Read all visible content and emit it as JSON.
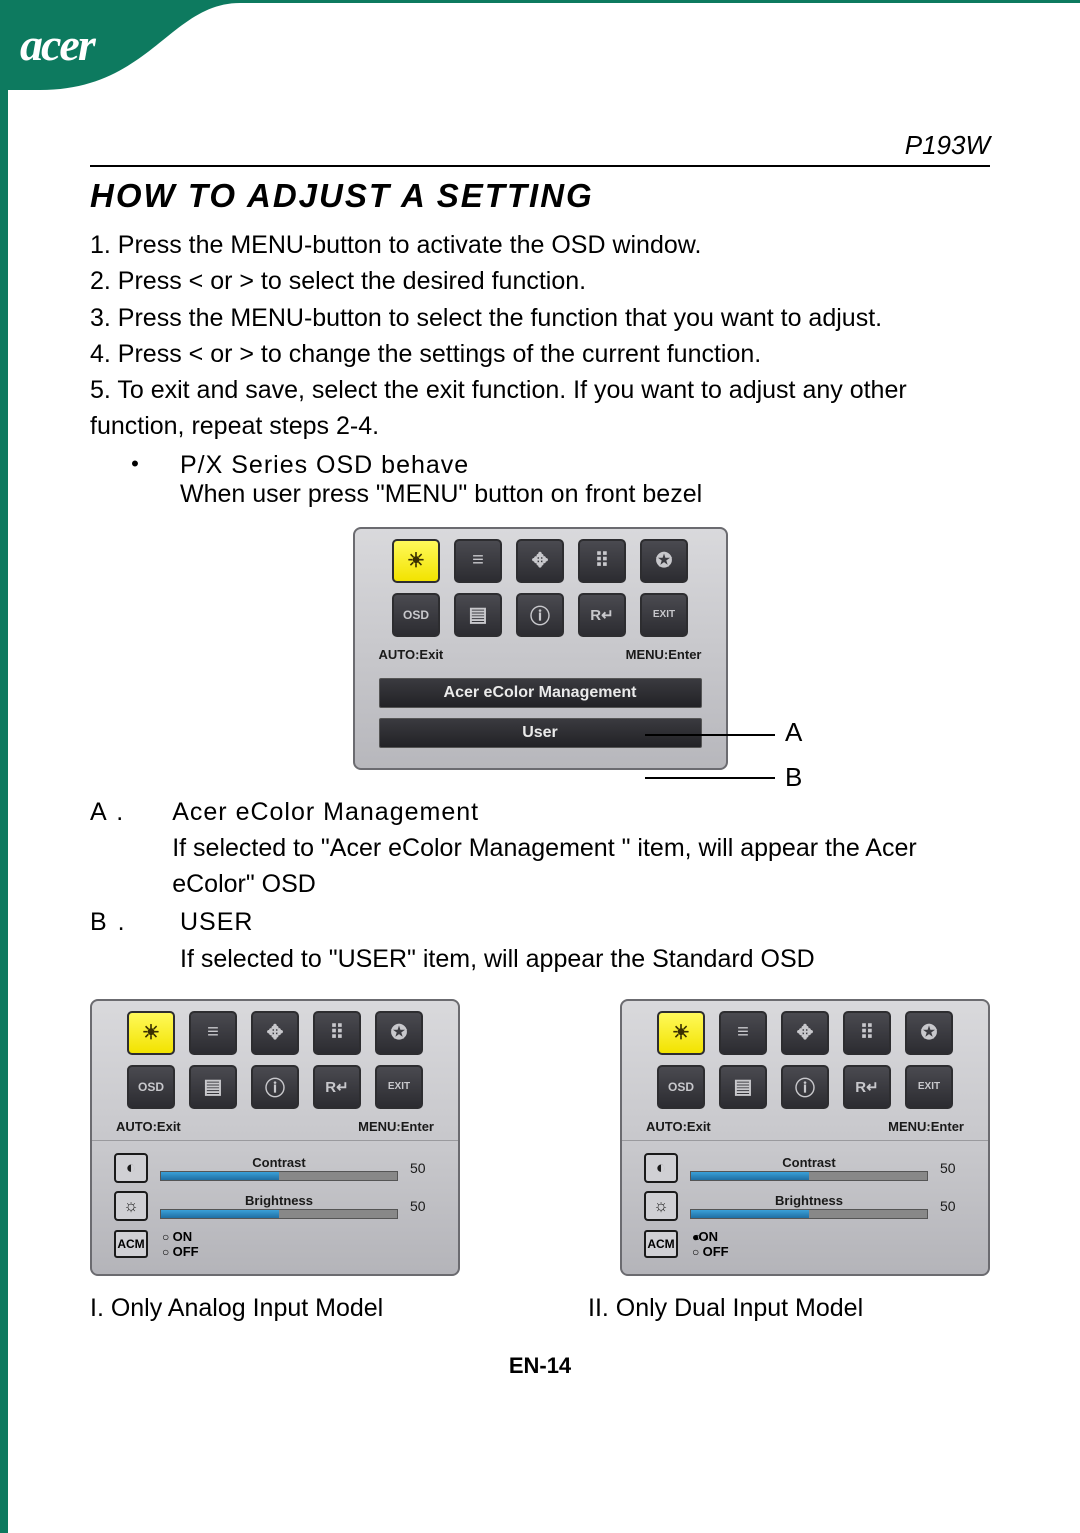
{
  "brand": "acer",
  "model": "P193W",
  "title": "HOW TO ADJUST A SETTING",
  "steps": [
    "1. Press the MENU-button  to activate the OSD window.",
    "2. Press < or  > to select the desired function.",
    "3. Press the MENU-button  to select the function that you want to adjust.",
    "4. Press < or  > to change the settings of the current function.",
    "5. To exit and save, select the exit function. If you want to adjust any other function, repeat steps 2-4."
  ],
  "series_bullet": {
    "head": "P/X Series OSD behave",
    "body": "When user press \"MENU\" button on front bezel"
  },
  "osd": {
    "hints": {
      "left": "AUTO:Exit",
      "right": "MENU:Enter"
    },
    "icons_row1": [
      "brightness",
      "menu-list",
      "position",
      "color",
      "language"
    ],
    "icons_row2": [
      "osd",
      "input",
      "info",
      "reset",
      "exit"
    ],
    "bar_a": "Acer eColor Management",
    "bar_b": "User",
    "call_a": "A",
    "call_b": "B"
  },
  "defs": {
    "a": {
      "label": "A .",
      "head": "Acer eColor Management",
      "body": "If selected to \"Acer eColor Management \" item, will appear the Acer eColor\" OSD"
    },
    "b": {
      "label": "B .",
      "head": "USER",
      "body": "If selected to \"USER\" item, will appear the Standard OSD"
    }
  },
  "user_osd": {
    "contrast_label": "Contrast",
    "contrast_value": "50",
    "brightness_label": "Brightness",
    "brightness_value": "50",
    "acm_label": "ACM",
    "acm_on": "ON",
    "acm_off": "OFF"
  },
  "captions": {
    "left": "I. Only Analog Input Model",
    "right": "II. Only Dual Input Model"
  },
  "page_number": "EN-14",
  "icon_glyphs": {
    "brightness": "☀",
    "menu-list": "≡",
    "position": "✥",
    "color": "⠿",
    "language": "✪",
    "osd": "OSD",
    "input": "▤",
    "info": "ⓘ",
    "reset": "R↵",
    "exit": "EXIT",
    "contrast": "◐",
    "bright2": "☼"
  }
}
